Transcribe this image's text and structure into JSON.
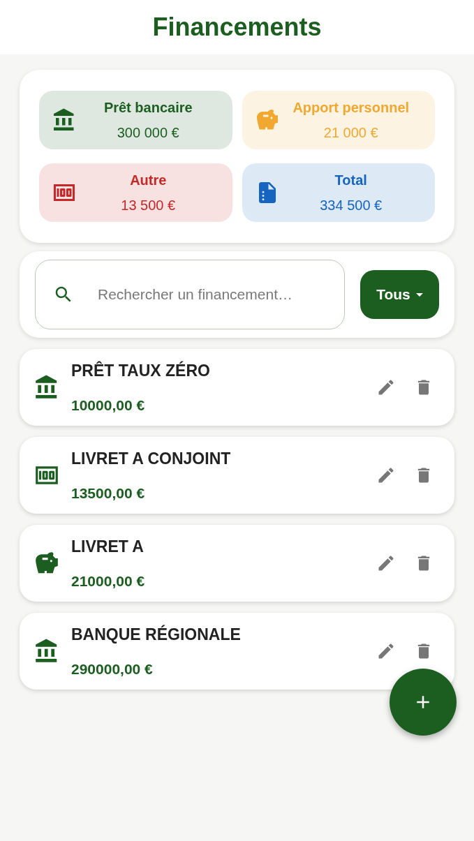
{
  "header": {
    "title": "Financements"
  },
  "summary": [
    {
      "kind": "bank",
      "label": "Prêt bancaire",
      "amount": "300 000 €",
      "color": "#1b5e20"
    },
    {
      "kind": "piggy",
      "label": "Apport personnel",
      "amount": "21 000 €",
      "color": "#f0a830"
    },
    {
      "kind": "cash",
      "label": "Autre",
      "amount": "13 500 €",
      "color": "#c62828"
    },
    {
      "kind": "document",
      "label": "Total",
      "amount": "334 500 €",
      "color": "#1565c0"
    }
  ],
  "search": {
    "placeholder": "Rechercher un financement…"
  },
  "filter": {
    "label": "Tous"
  },
  "items": [
    {
      "kind": "bank",
      "name": "PRÊT TAUX ZÉRO",
      "amount": "10000,00 €"
    },
    {
      "kind": "cash",
      "name": "LIVRET A CONJOINT",
      "amount": "13500,00 €"
    },
    {
      "kind": "piggy",
      "name": "LIVRET A",
      "amount": "21000,00 €"
    },
    {
      "kind": "bank",
      "name": "BANQUE RÉGIONALE",
      "amount": "290000,00 €"
    }
  ]
}
